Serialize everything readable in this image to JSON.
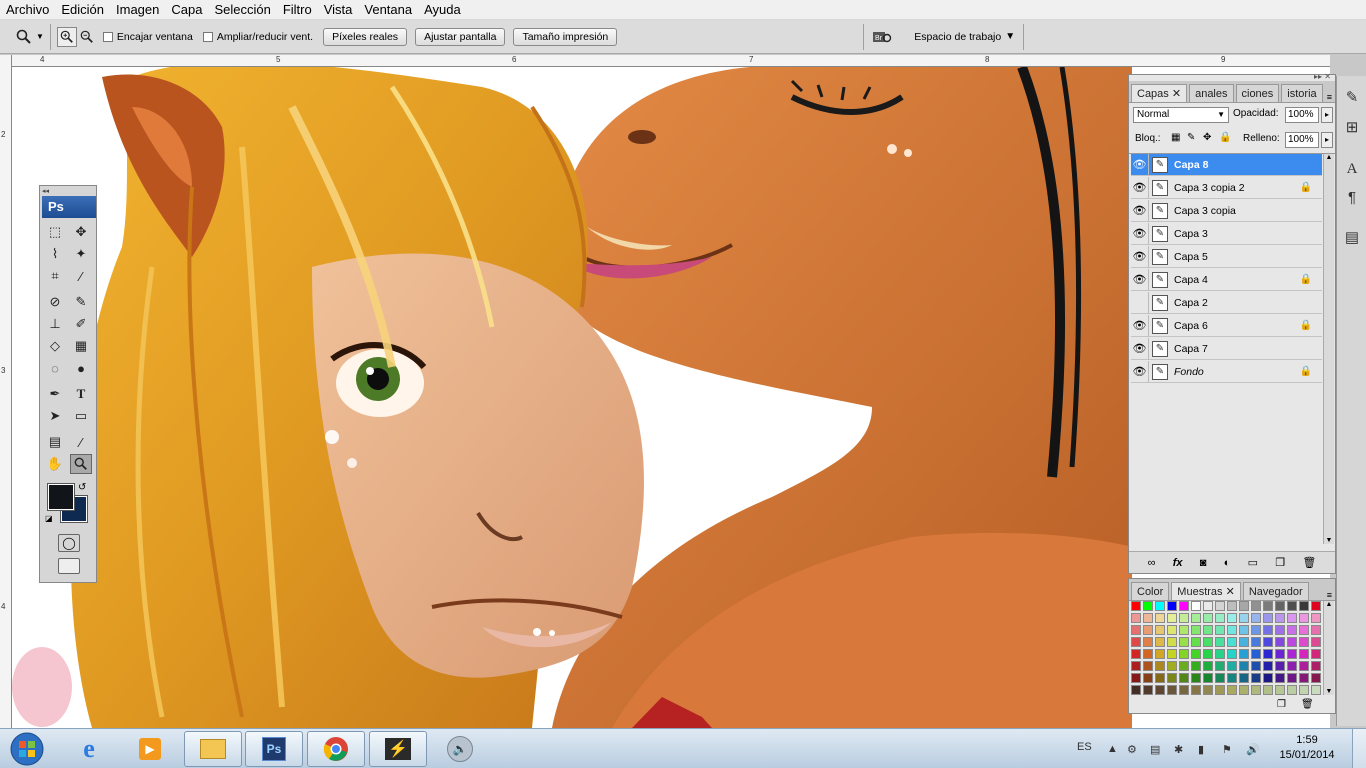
{
  "menu": [
    "Archivo",
    "Edición",
    "Imagen",
    "Capa",
    "Selección",
    "Filtro",
    "Vista",
    "Ventana",
    "Ayuda"
  ],
  "options": {
    "fit_window": "Encajar ventana",
    "resize_window": "Ampliar/reducir vent.",
    "actual_pixels": "Píxeles reales",
    "fit_screen": "Ajustar pantalla",
    "print_size": "Tamaño impresión",
    "workspace": "Espacio de trabajo"
  },
  "rulers": {
    "top": [
      "4",
      "5",
      "6",
      "7",
      "8",
      "9"
    ],
    "left": [
      "2",
      "3",
      "4"
    ]
  },
  "tools": {
    "logo": "Ps"
  },
  "layers_panel": {
    "tabs": [
      "Capas",
      "anales",
      "ciones",
      "istoria"
    ],
    "blend_mode": "Normal",
    "opacity_label": "Opacidad:",
    "opacity_value": "100%",
    "lock_label": "Bloq.:",
    "fill_label": "Relleno:",
    "fill_value": "100%",
    "layers": [
      {
        "name": "Capa 8",
        "visible": true,
        "locked": false,
        "selected": true
      },
      {
        "name": "Capa 3 copia 2",
        "visible": true,
        "locked": true,
        "selected": false
      },
      {
        "name": "Capa 3 copia",
        "visible": true,
        "locked": false,
        "selected": false
      },
      {
        "name": "Capa 3",
        "visible": true,
        "locked": false,
        "selected": false
      },
      {
        "name": "Capa 5",
        "visible": true,
        "locked": false,
        "selected": false
      },
      {
        "name": "Capa 4",
        "visible": true,
        "locked": true,
        "selected": false
      },
      {
        "name": "Capa 2",
        "visible": false,
        "locked": false,
        "selected": false
      },
      {
        "name": "Capa 6",
        "visible": true,
        "locked": true,
        "selected": false
      },
      {
        "name": "Capa 7",
        "visible": true,
        "locked": false,
        "selected": false
      },
      {
        "name": "Fondo",
        "visible": true,
        "locked": true,
        "selected": false
      }
    ]
  },
  "swatches_panel": {
    "tabs": [
      "Color",
      "Muestras",
      "Navegador"
    ]
  },
  "taskbar": {
    "language": "ES",
    "time": "1:59",
    "date": "15/01/2014"
  },
  "colors": {
    "selection_blue": "#3c8cf0",
    "foreground": "#111418",
    "background": "#0f2a50"
  }
}
